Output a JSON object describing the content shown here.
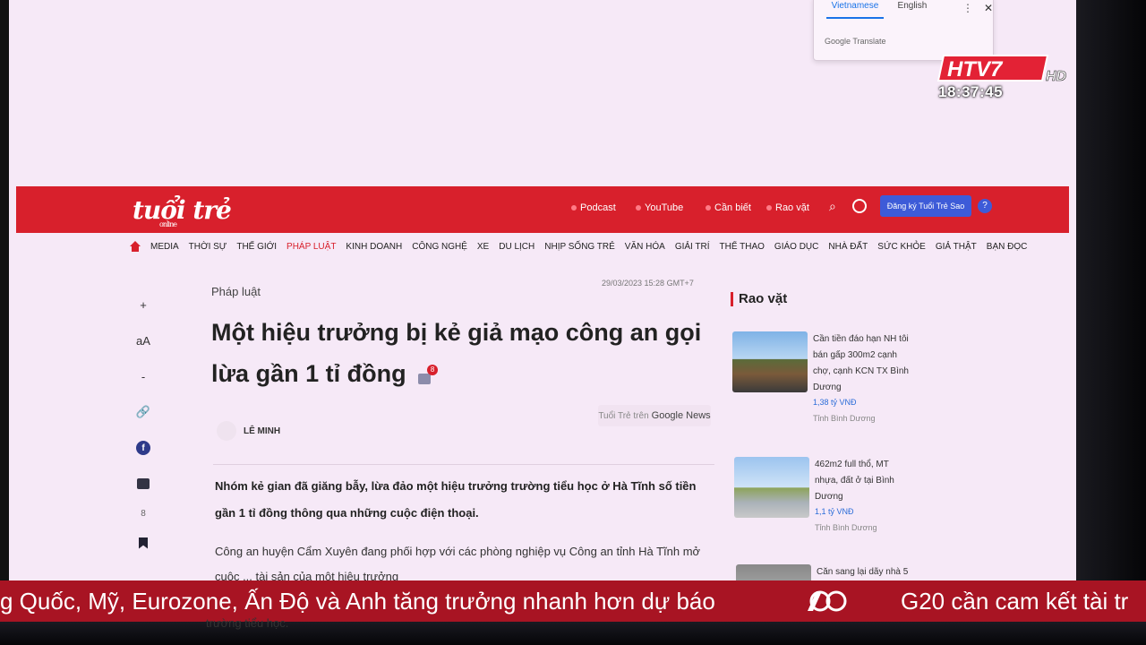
{
  "translate": {
    "tab_vi": "Vietnamese",
    "tab_en": "English",
    "more_icon": "⋮",
    "close_icon": "✕",
    "brand": "Google Translate"
  },
  "header": {
    "logo": "tuổi trẻ",
    "logo_sub": "online",
    "nav": [
      "Podcast",
      "YouTube",
      "Cần biết",
      "Rao vặt"
    ],
    "search_icon": "⌕",
    "subscribe": "Đăng ký Tuổi Trẻ Sao",
    "help": "?"
  },
  "menu": {
    "items": [
      "MEDIA",
      "THỜI SỰ",
      "THẾ GIỚI",
      "PHÁP LUẬT",
      "KINH DOANH",
      "CÔNG NGHỆ",
      "XE",
      "DU LỊCH",
      "NHỊP SỐNG TRẺ",
      "VĂN HÓA",
      "GIẢI TRÍ",
      "THỂ THAO",
      "GIÁO DỤC",
      "NHÀ ĐẤT",
      "SỨC KHỎE",
      "GIẢ THẬT",
      "BẠN ĐỌC"
    ],
    "active_index": 3
  },
  "tools": {
    "plus": "+",
    "font": "aA",
    "minus": "-",
    "link": "🔗",
    "facebook": "f",
    "count": "8"
  },
  "article": {
    "category": "Pháp luật",
    "date": "29/03/2023 15:28 GMT+7",
    "headline": "Một hiệu trưởng bị kẻ giả mạo công an gọi lừa gần 1 tỉ đồng",
    "comment_count": "8",
    "author": "LÊ MINH",
    "gnews_prefix": "Tuổi Trẻ trên",
    "gnews_brand": "Google News",
    "sapo": "Nhóm kẻ gian đã giăng bẫy, lừa đảo một hiệu trưởng trường tiểu học ở Hà Tĩnh số tiền gần 1 tỉ đồng thông qua những cuộc điện thoại.",
    "body": "Công an huyện Cẩm Xuyên đang phối hợp với các phòng nghiệp vụ Công an tỉnh Hà Tĩnh mở cuộc ... tài sản của một hiệu trưởng",
    "body_tail": "trường tiểu học."
  },
  "rail": {
    "title": "Rao vặt",
    "ads": [
      {
        "title": "Cần tiền đáo hạn NH tôi bán gấp 300m2 cạnh chợ, cạnh KCN TX Bình Dương",
        "price": "1,38 tỷ VNĐ",
        "loc": "Tỉnh Bình Dương"
      },
      {
        "title": "462m2 full thổ, MT nhựa, đất ở tại Bình Dương",
        "price": "1,1 tỷ VNĐ",
        "loc": "Tỉnh Bình Dương"
      },
      {
        "title": "Căn sang lại dãy nhà 5",
        "price": "",
        "loc": ""
      }
    ]
  },
  "tv": {
    "channel": "HTV7",
    "hd": "HD",
    "clock": "18:37:45",
    "ticker1": "g Quốc, Mỹ, Eurozone, Ấn Độ và Anh tăng trưởng nhanh hơn dự báo",
    "ticker2": "G20 cần cam kết tài tr"
  }
}
